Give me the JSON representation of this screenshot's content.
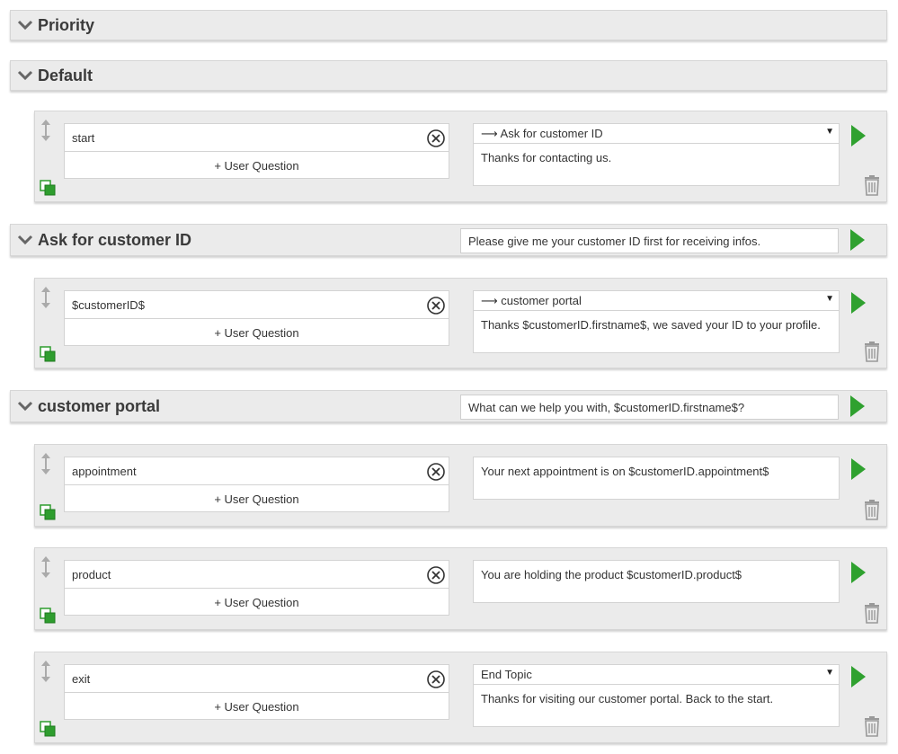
{
  "sections": {
    "priority": {
      "title": "Priority"
    },
    "default": {
      "title": "Default"
    },
    "ask": {
      "title": "Ask for customer ID",
      "prompt": "Please give me your customer ID first for receiving infos."
    },
    "portal": {
      "title": "customer portal",
      "prompt": "What can we help you with, $customerID.firstname$?"
    }
  },
  "cards": {
    "start": {
      "question": "start",
      "add_label": "+ User Question",
      "select": "⟶ Ask for customer ID",
      "answer": "Thanks for contacting us."
    },
    "customerid": {
      "question": "$customerID$",
      "add_label": "+ User Question",
      "select": "⟶ customer portal",
      "answer": "Thanks $customerID.firstname$, we saved your ID to your profile."
    },
    "appointment": {
      "question": "appointment",
      "add_label": "+ User Question",
      "answer": "Your next appointment is on $customerID.appointment$"
    },
    "product": {
      "question": "product",
      "add_label": "+ User Question",
      "answer": "You are holding the product $customerID.product$"
    },
    "exit": {
      "question": "exit",
      "add_label": "+ User Question",
      "select": "End Topic",
      "answer": "Thanks for visiting our customer portal. Back to the start."
    }
  },
  "colors": {
    "play": "#2fa12f",
    "copy_icon": "#2e9d2e",
    "header_bg": "#ebebeb"
  },
  "icons": {
    "collapse": "chevron-down-icon",
    "reorder": "up-down-arrows-icon",
    "copy": "copy-icon",
    "remove": "close-circle-icon",
    "run": "play-icon",
    "delete": "trash-icon"
  }
}
